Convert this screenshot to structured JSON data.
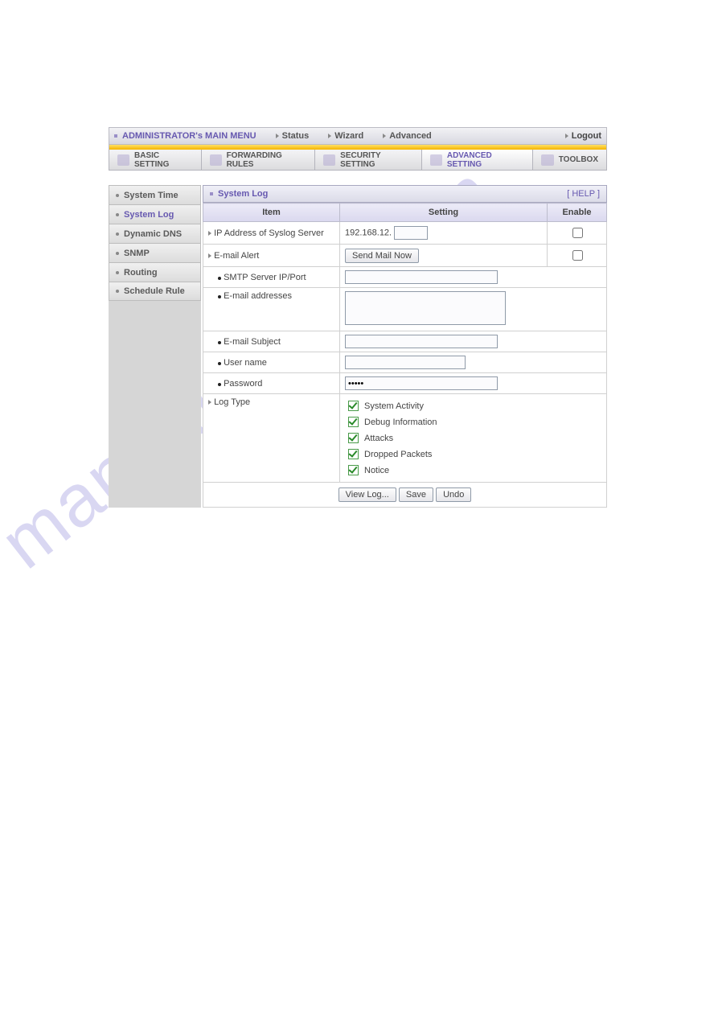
{
  "watermark": "manualshive.com",
  "topbar": {
    "main_title": "ADMINISTRATOR's MAIN MENU",
    "items": [
      {
        "label": "Status"
      },
      {
        "label": "Wizard"
      },
      {
        "label": "Advanced"
      }
    ],
    "logout": "Logout"
  },
  "tabs": [
    {
      "label": "BASIC SETTING",
      "active": false
    },
    {
      "label": "FORWARDING RULES",
      "active": false
    },
    {
      "label": "SECURITY SETTING",
      "active": false
    },
    {
      "label": "ADVANCED SETTING",
      "active": true
    },
    {
      "label": "TOOLBOX",
      "active": false
    }
  ],
  "sidebar": {
    "items": [
      {
        "label": "System Time",
        "active": false
      },
      {
        "label": "System Log",
        "active": true
      },
      {
        "label": "Dynamic DNS",
        "active": false
      },
      {
        "label": "SNMP",
        "active": false
      },
      {
        "label": "Routing",
        "active": false
      },
      {
        "label": "Schedule Rule",
        "active": false
      }
    ]
  },
  "panel": {
    "title": "System Log",
    "help": "[ HELP ]",
    "headers": {
      "item": "Item",
      "setting": "Setting",
      "enable": "Enable"
    },
    "rows": {
      "syslog": {
        "label": "IP Address of Syslog Server",
        "prefix": "192.168.12.",
        "suffix_value": ""
      },
      "email_alert": {
        "label": "E-mail Alert",
        "button": "Send Mail Now"
      },
      "smtp": {
        "label": "SMTP Server IP/Port",
        "value": ""
      },
      "addresses": {
        "label": "E-mail addresses",
        "value": ""
      },
      "subject": {
        "label": "E-mail Subject",
        "value": ""
      },
      "username": {
        "label": "User name",
        "value": ""
      },
      "password": {
        "label": "Password",
        "value": "•••••"
      },
      "logtype": {
        "label": "Log Type",
        "options": [
          "System Activity",
          "Debug Information",
          "Attacks",
          "Dropped Packets",
          "Notice"
        ]
      }
    },
    "actions": {
      "view_log": "View Log...",
      "save": "Save",
      "undo": "Undo"
    }
  }
}
